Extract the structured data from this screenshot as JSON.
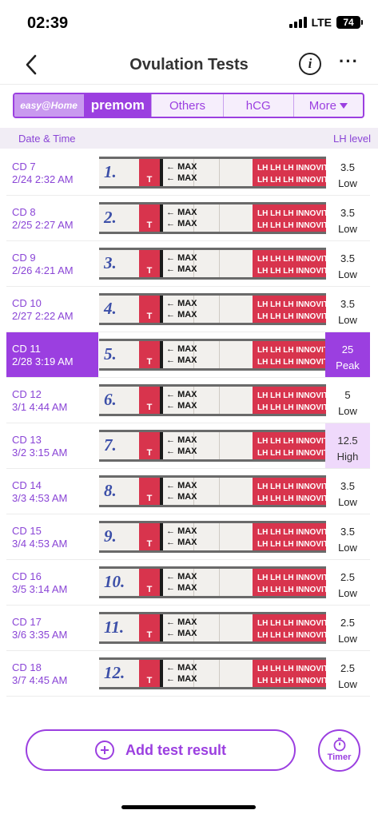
{
  "status_bar": {
    "time": "02:39",
    "network": "LTE",
    "battery": "74"
  },
  "nav": {
    "title": "Ovulation Tests",
    "info_glyph": "i",
    "more_glyph": "···"
  },
  "tabs": [
    {
      "label": "easy@Home",
      "selected": false
    },
    {
      "label": "premom",
      "selected": true
    },
    {
      "label": "Others",
      "selected": false
    },
    {
      "label": "hCG",
      "selected": false
    },
    {
      "label": "More",
      "selected": false
    }
  ],
  "table_header": {
    "left": "Date & Time",
    "right": "LH level"
  },
  "strip_text": {
    "max": "MAX",
    "t": "T",
    "brand": "LH LH LH INNOVITA L"
  },
  "rows": [
    {
      "cd": "CD 7",
      "datetime": "2/24 2:32 AM",
      "strip_no": "1.",
      "lh_value": "3.5",
      "lh_status": "Low"
    },
    {
      "cd": "CD 8",
      "datetime": "2/25 2:27 AM",
      "strip_no": "2.",
      "lh_value": "3.5",
      "lh_status": "Low"
    },
    {
      "cd": "CD 9",
      "datetime": "2/26 4:21 AM",
      "strip_no": "3.",
      "lh_value": "3.5",
      "lh_status": "Low"
    },
    {
      "cd": "CD 10",
      "datetime": "2/27 2:22 AM",
      "strip_no": "4.",
      "lh_value": "3.5",
      "lh_status": "Low"
    },
    {
      "cd": "CD 11",
      "datetime": "2/28 3:19 AM",
      "strip_no": "5.",
      "lh_value": "25",
      "lh_status": "Peak"
    },
    {
      "cd": "CD 12",
      "datetime": "3/1 4:44 AM",
      "strip_no": "6.",
      "lh_value": "5",
      "lh_status": "Low"
    },
    {
      "cd": "CD 13",
      "datetime": "3/2 3:15 AM",
      "strip_no": "7.",
      "lh_value": "12.5",
      "lh_status": "High"
    },
    {
      "cd": "CD 14",
      "datetime": "3/3 4:53 AM",
      "strip_no": "8.",
      "lh_value": "3.5",
      "lh_status": "Low"
    },
    {
      "cd": "CD 15",
      "datetime": "3/4 4:53 AM",
      "strip_no": "9.",
      "lh_value": "3.5",
      "lh_status": "Low"
    },
    {
      "cd": "CD 16",
      "datetime": "3/5 3:14 AM",
      "strip_no": "10.",
      "lh_value": "2.5",
      "lh_status": "Low"
    },
    {
      "cd": "CD 17",
      "datetime": "3/6 3:35 AM",
      "strip_no": "11.",
      "lh_value": "2.5",
      "lh_status": "Low"
    },
    {
      "cd": "CD 18",
      "datetime": "3/7 4:45 AM",
      "strip_no": "12.",
      "lh_value": "2.5",
      "lh_status": "Low"
    }
  ],
  "bottom": {
    "add_label": "Add test result",
    "timer_label": "Timer"
  },
  "colors": {
    "accent": "#9b3fe0",
    "peak_bg": "#9b3fe0",
    "high_bg": "#efd9fb",
    "strip_red": "#d8344d"
  }
}
